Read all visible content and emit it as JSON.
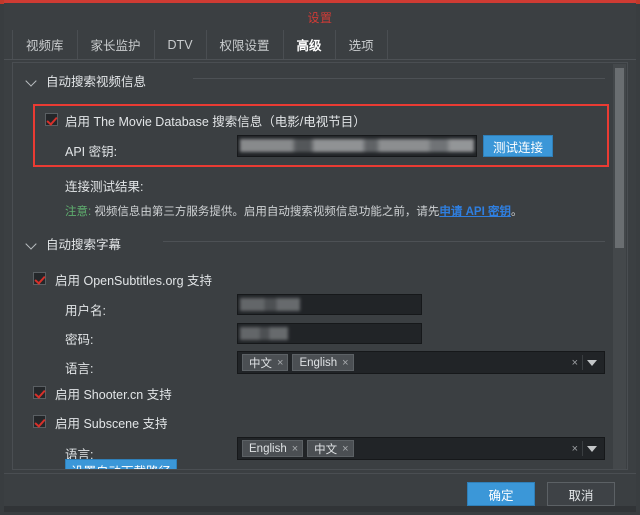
{
  "window": {
    "title": "设置",
    "accent_color": "#cf3b33",
    "background": "#3b3f42"
  },
  "tabs": [
    {
      "label": "视频库",
      "active": false
    },
    {
      "label": "家长监护",
      "active": false
    },
    {
      "label": "DTV",
      "active": false
    },
    {
      "label": "权限设置",
      "active": false
    },
    {
      "label": "高级",
      "active": true
    },
    {
      "label": "选项",
      "active": false
    }
  ],
  "groups": {
    "video_info": {
      "header": "自动搜索视频信息",
      "tmdb_checkbox_label": "启用 The Movie Database 搜索信息（电影/电视节目）",
      "tmdb_checked": true,
      "api_key_label": "API 密钥:",
      "api_key_value": "",
      "test_button": "测试连接",
      "test_result_label": "连接测试结果:",
      "test_result_value": "",
      "note_warn": "注意:",
      "note_body": " 视频信息由第三方服务提供。启用自动搜索视频信息功能之前，请先",
      "note_link": "申请 API 密钥",
      "note_tail": "。",
      "highlight_color": "#ea3b33"
    },
    "subtitles": {
      "header": "自动搜索字幕",
      "opensubtitles_label": "启用 OpenSubtitles.org 支持",
      "opensubtitles_checked": true,
      "username_label": "用户名:",
      "username_value": "",
      "password_label": "密码:",
      "password_value": "",
      "language_label": "语言:",
      "os_languages": [
        "中文",
        "English"
      ],
      "shooter_label": "启用 Shooter.cn 支持",
      "shooter_checked": true,
      "subscene_label": "启用 Subscene 支持",
      "subscene_checked": true,
      "subscene_language_label": "语言:",
      "subscene_languages": [
        "English",
        "中文"
      ],
      "download_path_button": "设置自动下载路径"
    }
  },
  "footer": {
    "ok_label": "确定",
    "cancel_label": "取消",
    "ok_color": "#3b97d8"
  },
  "icons": {
    "chevron_down": "chevron-down-icon",
    "remove_tag": "×",
    "clear_all": "×",
    "dropdown_caret": "▼"
  }
}
